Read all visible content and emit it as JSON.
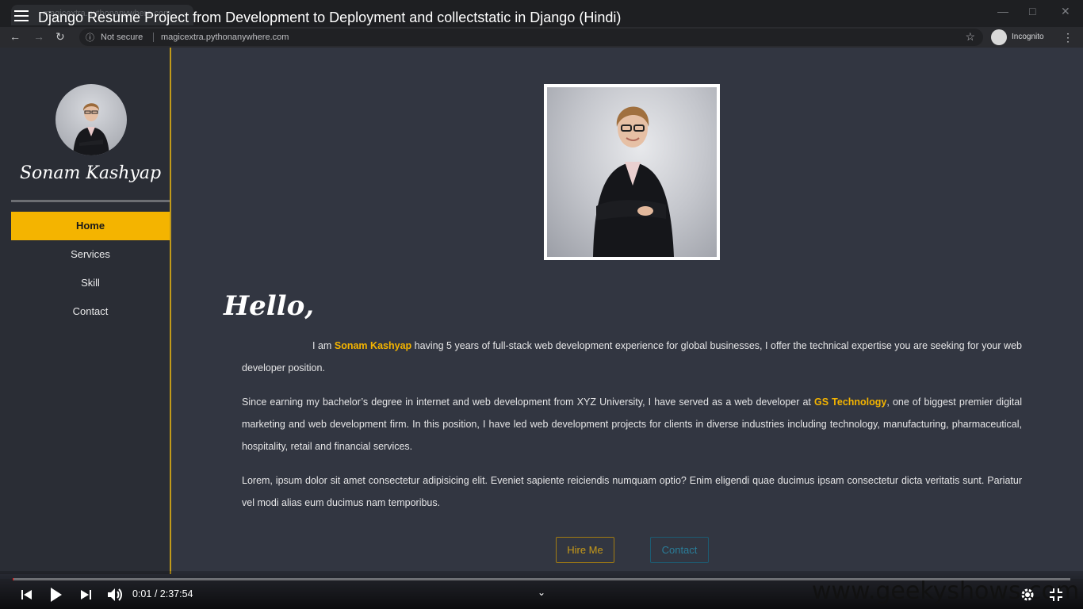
{
  "video": {
    "title": "Django Resume Project from Development to Deployment and collectstatic in Django (Hindi)",
    "time_current": "0:01",
    "time_sep": " / ",
    "time_total": "2:37:54",
    "watermark": "www.geekyshows.com",
    "progress_fraction": 0.0001
  },
  "browser": {
    "tab_title": "magicextra.pythonanywhere.com",
    "security_label": "Not secure",
    "url": "magicextra.pythonanywhere.com",
    "profile_label": "Incognito"
  },
  "sidebar": {
    "name": "Sonam Kashyap",
    "items": [
      {
        "label": "Home",
        "active": true
      },
      {
        "label": "Services",
        "active": false
      },
      {
        "label": "Skill",
        "active": false
      },
      {
        "label": "Contact",
        "active": false
      }
    ]
  },
  "main": {
    "greeting": "Hello,",
    "intro": {
      "before": "I am ",
      "name": "Sonam Kashyap",
      "after": " having 5 years of full-stack web development experience for global businesses, I offer the technical expertise you are seeking for your web developer position."
    },
    "experience": {
      "before": "Since earning my bachelor’s degree in internet and web development from XYZ University, I have served as a web developer at ",
      "company": "GS Technology",
      "after": ", one of biggest premier digital marketing and web development firm. In this position, I have led web development projects for clients in diverse industries including technology, manufacturing, pharmaceutical, hospitality, retail and financial services."
    },
    "lorem": "Lorem, ipsum dolor sit amet consectetur adipisicing elit. Eveniet sapiente reiciendis numquam optio? Enim eligendi quae ducimus ipsam consectetur dicta veritatis sunt. Pariatur vel modi alias eum ducimus nam temporibus.",
    "hire_label": "Hire Me",
    "contact_label": "Contact"
  },
  "colors": {
    "accent": "#f4b400",
    "sidebar_bg": "#2a2d35",
    "page_bg": "#323641",
    "contact_btn": "#2a7d99"
  }
}
